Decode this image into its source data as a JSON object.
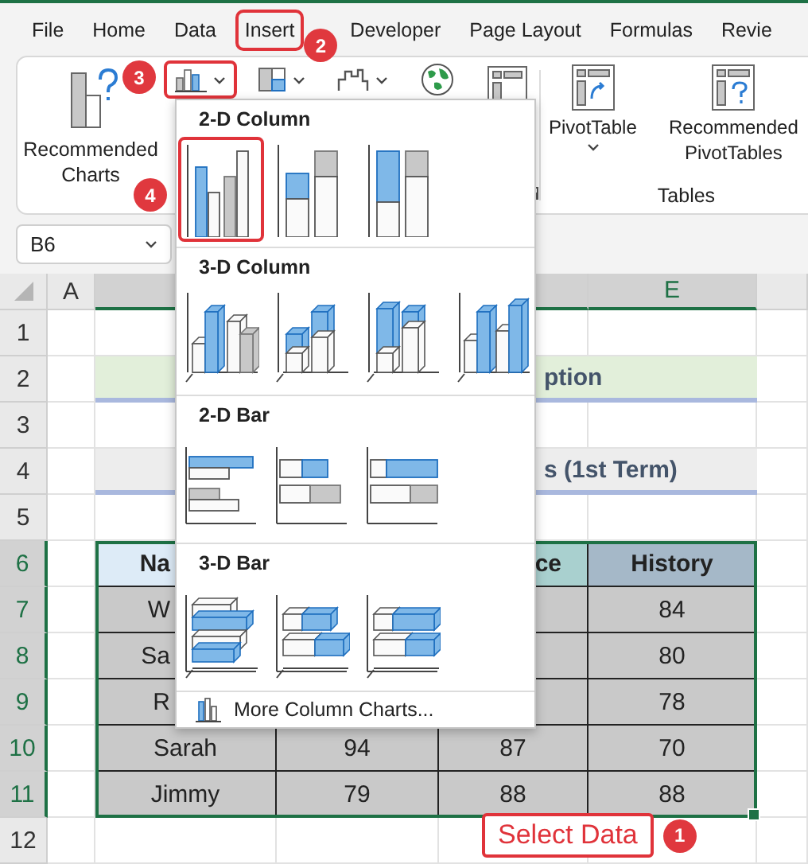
{
  "tabs": [
    {
      "label": "File",
      "selected": false
    },
    {
      "label": "Home",
      "selected": false
    },
    {
      "label": "Data",
      "selected": false
    },
    {
      "label": "Insert",
      "selected": true,
      "badge": "2"
    },
    {
      "label": "Developer",
      "selected": false
    },
    {
      "label": "Page Layout",
      "selected": false
    },
    {
      "label": "Formulas",
      "selected": false
    },
    {
      "label": "Revie",
      "selected": false
    }
  ],
  "ribbon": {
    "recommended_charts": {
      "label": "Recommended Charts"
    },
    "column_chart_button": {
      "highlighted": true,
      "badge": "3"
    },
    "tables_group": {
      "title": "Tables",
      "buttons": [
        {
          "label": "PivotTable",
          "kind": "dropdown"
        },
        {
          "label": "Recommended PivotTables",
          "kind": "plain"
        }
      ]
    }
  },
  "name_box": {
    "value": "B6"
  },
  "sheet": {
    "columns": [
      {
        "label": "A",
        "selected": false
      },
      {
        "selected": true
      },
      {},
      {
        "selected": true
      },
      {
        "label": "E",
        "selected": true
      },
      {
        "selected": false
      }
    ],
    "rows": [
      {
        "number": "1",
        "selected": false,
        "kind": "blank"
      },
      {
        "number": "2",
        "selected": false,
        "kind": "title",
        "text": "ption"
      },
      {
        "number": "3",
        "selected": false,
        "kind": "blank"
      },
      {
        "number": "4",
        "selected": false,
        "kind": "subtitle",
        "text": "s (1st Term)"
      },
      {
        "number": "5",
        "selected": false,
        "kind": "blank"
      },
      {
        "number": "6",
        "selected": true,
        "kind": "header",
        "cells": [
          "Na",
          null,
          "ce",
          "History"
        ]
      },
      {
        "number": "7",
        "selected": true,
        "kind": "data",
        "cells": [
          "W",
          null,
          null,
          "84"
        ]
      },
      {
        "number": "8",
        "selected": true,
        "kind": "data",
        "cells": [
          "Sa",
          null,
          null,
          "80"
        ]
      },
      {
        "number": "9",
        "selected": true,
        "kind": "data",
        "cells": [
          "R",
          null,
          null,
          "78"
        ]
      },
      {
        "number": "10",
        "selected": true,
        "kind": "data",
        "cells": [
          "Sarah",
          "94",
          "87",
          "70"
        ]
      },
      {
        "number": "11",
        "selected": true,
        "kind": "data",
        "cells": [
          "Jimmy",
          "79",
          "88",
          "88"
        ]
      },
      {
        "number": "12",
        "selected": false,
        "kind": "blank"
      }
    ]
  },
  "chart_menu": {
    "sections": [
      {
        "title": "2-D Column",
        "kind": "column2d",
        "items": [
          {
            "selected": true
          },
          {
            "selected": false
          },
          {
            "selected": false
          }
        ]
      },
      {
        "title": "3-D Column",
        "kind": "column3d",
        "items": [
          {
            "selected": false
          },
          {
            "selected": false
          },
          {
            "selected": false
          },
          {
            "selected": false
          }
        ]
      },
      {
        "title": "2-D Bar",
        "kind": "bar2d",
        "items": [
          {
            "selected": false
          },
          {
            "selected": false
          },
          {
            "selected": false
          }
        ]
      },
      {
        "title": "3-D Bar",
        "kind": "bar3d",
        "items": [
          {
            "selected": false
          },
          {
            "selected": false
          },
          {
            "selected": false
          }
        ]
      }
    ],
    "more_link": "More Column Charts...",
    "step_badge": "4"
  },
  "callout": {
    "label": "Select Data",
    "badge": "1"
  }
}
